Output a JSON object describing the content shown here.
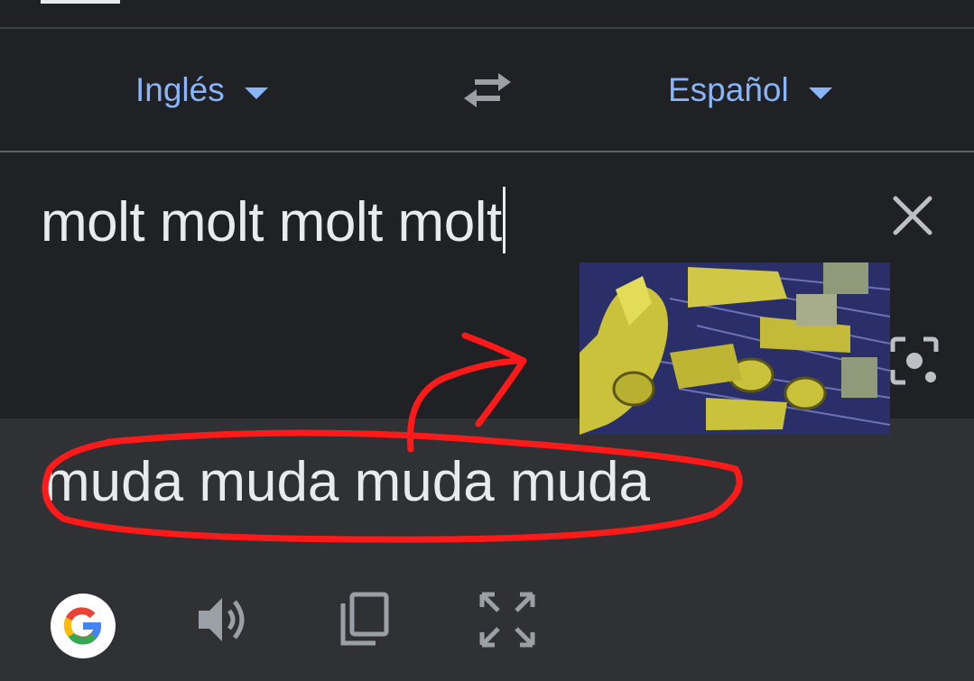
{
  "languages": {
    "source": "Inglés",
    "target": "Español"
  },
  "input": {
    "text": "molt molt molt molt"
  },
  "output": {
    "text": "muda muda muda muda"
  },
  "icons": {
    "swap": "swap-arrows-icon",
    "clear": "close-icon",
    "camera": "camera-lens-icon",
    "google": "google-logo",
    "speaker": "speaker-icon",
    "copy": "copy-icon",
    "fullscreen": "fullscreen-icon"
  },
  "colors": {
    "background": "#202124",
    "output_background": "#303134",
    "accent": "#8ab4f8",
    "text": "#e8eaed",
    "icon": "#9aa0a6",
    "scribble": "#ff0000"
  }
}
